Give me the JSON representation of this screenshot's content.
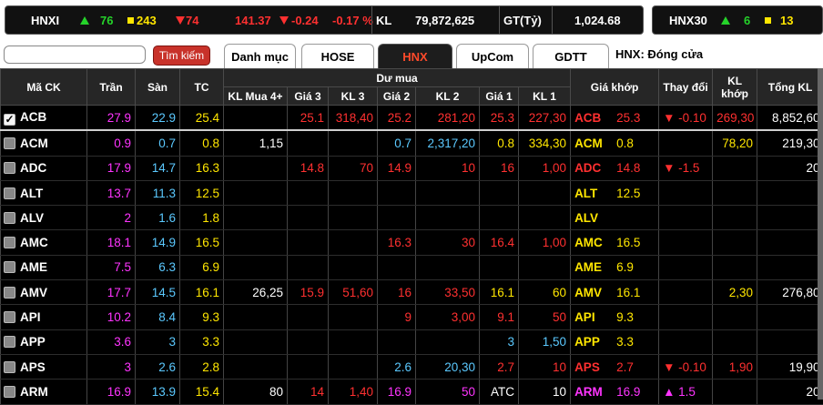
{
  "ticker": {
    "hnx": {
      "name": "HNXI",
      "advances": "76",
      "unchanged": "243",
      "declines": "74",
      "index": "141.37",
      "change": "-0.24",
      "pct": "-0.17 %",
      "kl_label": "KL",
      "volume": "79,872,625",
      "gt_label": "GT(Tỷ)",
      "value": "1,024.68"
    },
    "hnx30": {
      "name": "HNX30",
      "advances": "6",
      "unchanged": "13"
    }
  },
  "toolbar": {
    "search_placeholder": "",
    "search_label": "Tìm kiếm",
    "tabs": [
      "Danh mục",
      "HOSE",
      "HNX",
      "UpCom",
      "GDTT"
    ],
    "active_tab": "HNX",
    "status": "HNX:  Đóng cửa"
  },
  "headers": {
    "code": "Mã CK",
    "ceil": "Trần",
    "floor": "Sàn",
    "ref": "TC",
    "bid_group": "Dư mua",
    "kl_mua4": "KL Mua 4+",
    "gia3": "Giá 3",
    "kl3": "KL 3",
    "gia2": "Giá 2",
    "kl2": "KL 2",
    "gia1": "Giá 1",
    "kl1": "KL 1",
    "match_price": "Giá khớp",
    "change": "Thay đổi",
    "match_vol": "KL khớp",
    "total_vol": "Tổng KL"
  },
  "colors": {
    "ceiling": "#ff34ff",
    "floor": "#5bc9ff",
    "reference": "#ffe600",
    "down": "#ff3030",
    "up": "#25d32a",
    "active_tab": "#ff4a2a"
  },
  "rows": [
    {
      "code": "ACB",
      "checked": true,
      "ceil": "27.9",
      "floor": "22.9",
      "ref": "25.4",
      "kl4": "",
      "g3": "25.1",
      "k3": "318,40",
      "g2": "25.2",
      "k2": "281,20",
      "g1": "25.3",
      "k1": "227,30",
      "mcode": "ACB",
      "mprice": "25.3",
      "chg": "▼ -0.10",
      "mvol": "269,30",
      "tot": "8,852,60",
      "cls": {
        "g3": "c-red",
        "k3": "c-red",
        "g2": "c-red",
        "k2": "c-red",
        "g1": "c-red",
        "k1": "c-red",
        "m": "c-red",
        "chg": "c-red",
        "mvol": "c-red"
      }
    },
    {
      "code": "ACM",
      "checked": false,
      "ceil": "0.9",
      "floor": "0.7",
      "ref": "0.8",
      "kl4": "1,15",
      "g3": "",
      "k3": "",
      "g2": "0.7",
      "k2": "2,317,20",
      "g1": "0.8",
      "k1": "334,30",
      "mcode": "ACM",
      "mprice": "0.8",
      "chg": "",
      "mvol": "78,20",
      "tot": "219,30",
      "cls": {
        "g3": "c-white",
        "k3": "c-white",
        "g2": "c-floor",
        "k2": "c-floor",
        "g1": "c-ref",
        "k1": "c-ref",
        "m": "c-ref",
        "chg": "c-ref",
        "mvol": "c-ref"
      }
    },
    {
      "code": "ADC",
      "checked": false,
      "ceil": "17.9",
      "floor": "14.7",
      "ref": "16.3",
      "kl4": "",
      "g3": "14.8",
      "k3": "70",
      "g2": "14.9",
      "k2": "10",
      "g1": "16",
      "k1": "1,00",
      "mcode": "ADC",
      "mprice": "14.8",
      "chg": "▼ -1.5",
      "mvol": "",
      "tot": "20",
      "cls": {
        "g3": "c-red",
        "k3": "c-red",
        "g2": "c-red",
        "k2": "c-red",
        "g1": "c-red",
        "k1": "c-red",
        "m": "c-red",
        "chg": "c-red",
        "mvol": "c-red"
      }
    },
    {
      "code": "ALT",
      "checked": false,
      "ceil": "13.7",
      "floor": "11.3",
      "ref": "12.5",
      "kl4": "",
      "g3": "",
      "k3": "",
      "g2": "",
      "k2": "",
      "g1": "",
      "k1": "",
      "mcode": "ALT",
      "mprice": "12.5",
      "chg": "",
      "mvol": "",
      "tot": "",
      "cls": {
        "g3": "c-white",
        "k3": "c-white",
        "g2": "c-white",
        "k2": "c-white",
        "g1": "c-white",
        "k1": "c-white",
        "m": "c-ref",
        "chg": "c-ref",
        "mvol": "c-ref"
      }
    },
    {
      "code": "ALV",
      "checked": false,
      "ceil": "2",
      "floor": "1.6",
      "ref": "1.8",
      "kl4": "",
      "g3": "",
      "k3": "",
      "g2": "",
      "k2": "",
      "g1": "",
      "k1": "",
      "mcode": "ALV",
      "mprice": "",
      "chg": "",
      "mvol": "",
      "tot": "",
      "cls": {
        "g3": "c-white",
        "k3": "c-white",
        "g2": "c-white",
        "k2": "c-white",
        "g1": "c-white",
        "k1": "c-white",
        "m": "c-ref",
        "chg": "c-ref",
        "mvol": "c-ref"
      }
    },
    {
      "code": "AMC",
      "checked": false,
      "ceil": "18.1",
      "floor": "14.9",
      "ref": "16.5",
      "kl4": "",
      "g3": "",
      "k3": "",
      "g2": "16.3",
      "k2": "30",
      "g1": "16.4",
      "k1": "1,00",
      "mcode": "AMC",
      "mprice": "16.5",
      "chg": "",
      "mvol": "",
      "tot": "",
      "cls": {
        "g3": "c-white",
        "k3": "c-white",
        "g2": "c-red",
        "k2": "c-red",
        "g1": "c-red",
        "k1": "c-red",
        "m": "c-ref",
        "chg": "c-ref",
        "mvol": "c-ref"
      }
    },
    {
      "code": "AME",
      "checked": false,
      "ceil": "7.5",
      "floor": "6.3",
      "ref": "6.9",
      "kl4": "",
      "g3": "",
      "k3": "",
      "g2": "",
      "k2": "",
      "g1": "",
      "k1": "",
      "mcode": "AME",
      "mprice": "6.9",
      "chg": "",
      "mvol": "",
      "tot": "",
      "cls": {
        "g3": "c-white",
        "k3": "c-white",
        "g2": "c-white",
        "k2": "c-white",
        "g1": "c-white",
        "k1": "c-white",
        "m": "c-ref",
        "chg": "c-ref",
        "mvol": "c-ref"
      }
    },
    {
      "code": "AMV",
      "checked": false,
      "ceil": "17.7",
      "floor": "14.5",
      "ref": "16.1",
      "kl4": "26,25",
      "g3": "15.9",
      "k3": "51,60",
      "g2": "16",
      "k2": "33,50",
      "g1": "16.1",
      "k1": "60",
      "mcode": "AMV",
      "mprice": "16.1",
      "chg": "",
      "mvol": "2,30",
      "tot": "276,80",
      "cls": {
        "g3": "c-red",
        "k3": "c-red",
        "g2": "c-red",
        "k2": "c-red",
        "g1": "c-ref",
        "k1": "c-ref",
        "m": "c-ref",
        "chg": "c-ref",
        "mvol": "c-ref"
      }
    },
    {
      "code": "API",
      "checked": false,
      "ceil": "10.2",
      "floor": "8.4",
      "ref": "9.3",
      "kl4": "",
      "g3": "",
      "k3": "",
      "g2": "9",
      "k2": "3,00",
      "g1": "9.1",
      "k1": "50",
      "mcode": "API",
      "mprice": "9.3",
      "chg": "",
      "mvol": "",
      "tot": "",
      "cls": {
        "g3": "c-white",
        "k3": "c-white",
        "g2": "c-red",
        "k2": "c-red",
        "g1": "c-red",
        "k1": "c-red",
        "m": "c-ref",
        "chg": "c-ref",
        "mvol": "c-ref"
      }
    },
    {
      "code": "APP",
      "checked": false,
      "ceil": "3.6",
      "floor": "3",
      "ref": "3.3",
      "kl4": "",
      "g3": "",
      "k3": "",
      "g2": "",
      "k2": "",
      "g1": "3",
      "k1": "1,50",
      "mcode": "APP",
      "mprice": "3.3",
      "chg": "",
      "mvol": "",
      "tot": "",
      "cls": {
        "g3": "c-white",
        "k3": "c-white",
        "g2": "c-white",
        "k2": "c-white",
        "g1": "c-floor",
        "k1": "c-floor",
        "m": "c-ref",
        "chg": "c-ref",
        "mvol": "c-ref"
      }
    },
    {
      "code": "APS",
      "checked": false,
      "ceil": "3",
      "floor": "2.6",
      "ref": "2.8",
      "kl4": "",
      "g3": "",
      "k3": "",
      "g2": "2.6",
      "k2": "20,30",
      "g1": "2.7",
      "k1": "10",
      "mcode": "APS",
      "mprice": "2.7",
      "chg": "▼ -0.10",
      "mvol": "1,90",
      "tot": "19,90",
      "cls": {
        "g3": "c-white",
        "k3": "c-white",
        "g2": "c-floor",
        "k2": "c-floor",
        "g1": "c-red",
        "k1": "c-red",
        "m": "c-red",
        "chg": "c-red",
        "mvol": "c-red"
      }
    },
    {
      "code": "ARM",
      "checked": false,
      "ceil": "16.9",
      "floor": "13.9",
      "ref": "15.4",
      "kl4": "80",
      "g3": "14",
      "k3": "1,40",
      "g2": "16.9",
      "k2": "50",
      "g1": "ATC",
      "k1": "10",
      "mcode": "ARM",
      "mprice": "16.9",
      "chg": "▲ 1.5",
      "mvol": "",
      "tot": "20",
      "cls": {
        "g3": "c-red",
        "k3": "c-red",
        "g2": "c-ceil",
        "k2": "c-ceil",
        "g1": "c-white",
        "k1": "c-white",
        "m": "c-ceil",
        "chg": "c-ceil",
        "mvol": "c-ceil"
      }
    }
  ]
}
